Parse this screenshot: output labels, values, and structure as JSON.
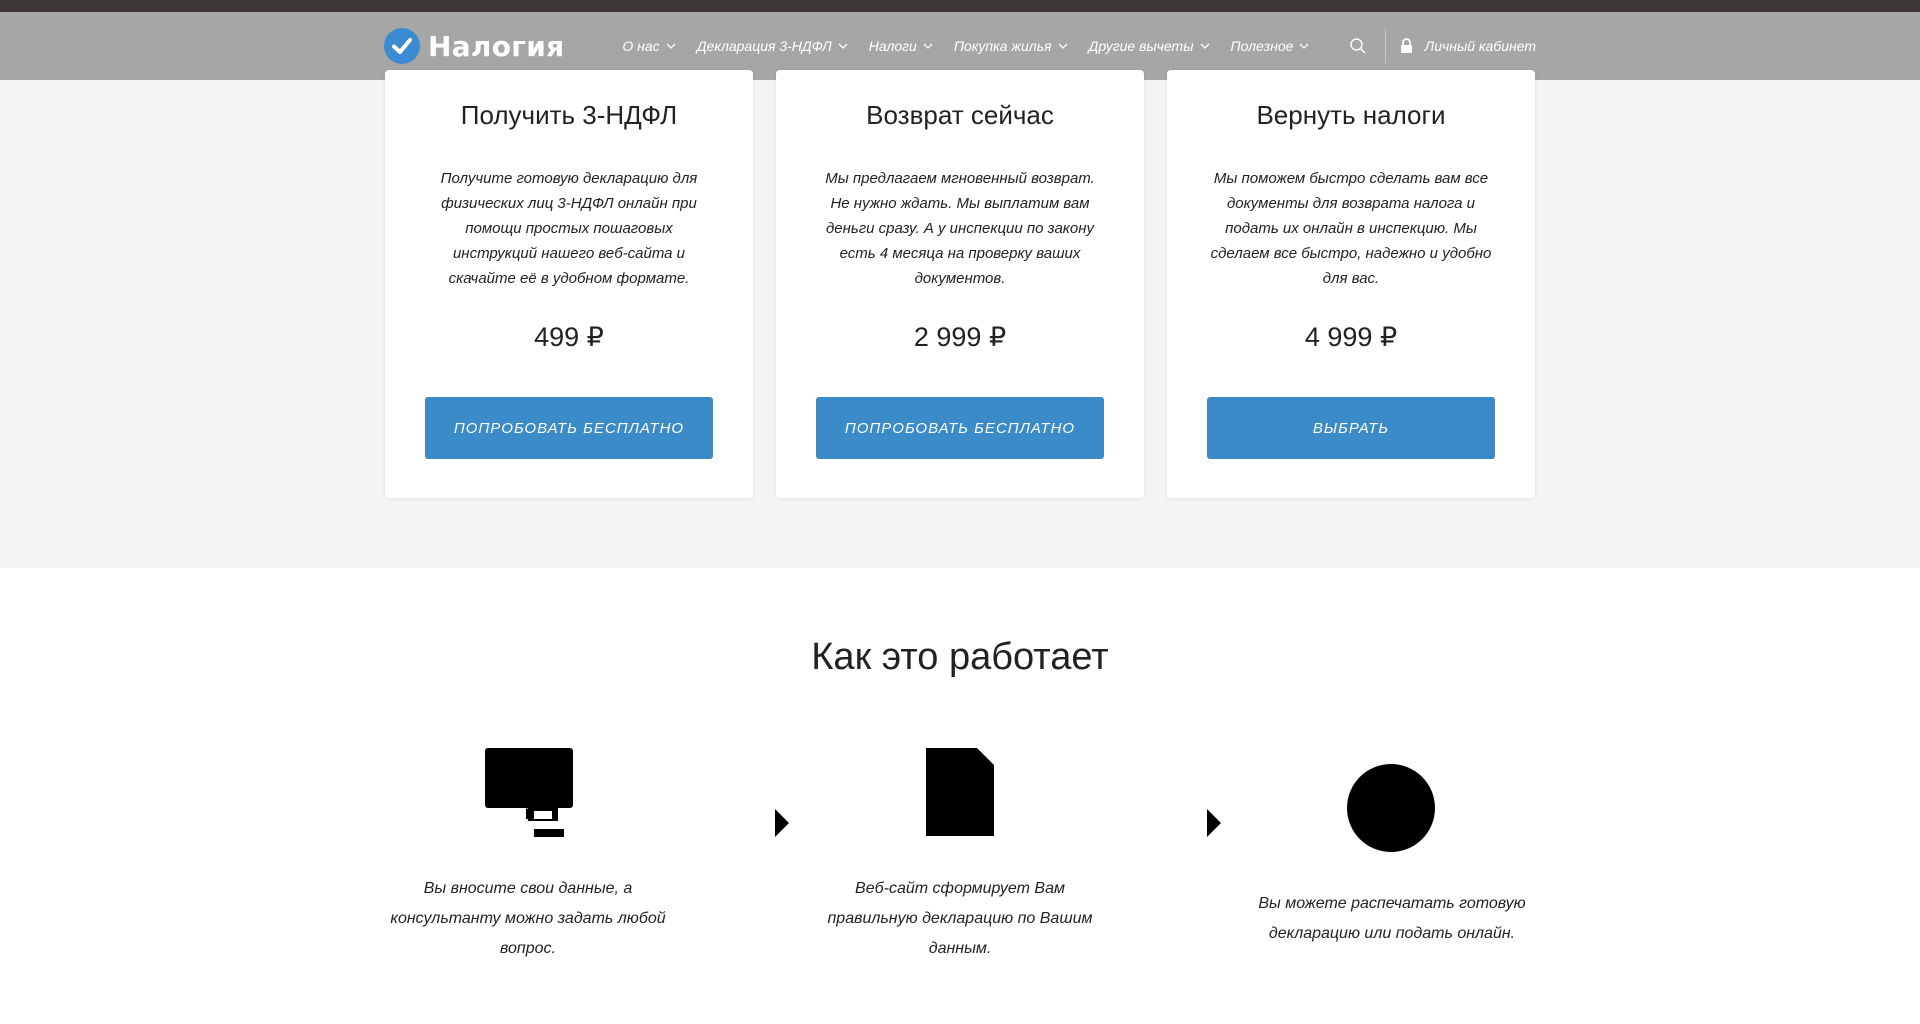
{
  "header": {
    "logo_text": "Налогия",
    "nav": [
      {
        "label": "О нас"
      },
      {
        "label": "Декларация 3-НДФЛ"
      },
      {
        "label": "Налоги"
      },
      {
        "label": "Покупка жилья"
      },
      {
        "label": "Другие вычеты"
      },
      {
        "label": "Полезное"
      }
    ],
    "account_label": "Личный кабинет"
  },
  "pricing": {
    "cards": [
      {
        "title": "Получить 3-НДФЛ",
        "description": "Получите готовую декларацию для физических лиц 3-НДФЛ онлайн при помощи простых пошаговых инструкций нашего веб-сайта и скачайте её в удобном формате.",
        "price": "499 ₽",
        "button": "ПОПРОБОВАТЬ БЕСПЛАТНО"
      },
      {
        "title": "Возврат сейчас",
        "description": "Мы предлагаем мгновенный возврат. Не нужно ждать. Мы выплатим вам деньги сразу. А у инспекции по закону есть 4 месяца на проверку ваших документов.",
        "price": "2 999 ₽",
        "button": "ПОПРОБОВАТЬ БЕСПЛАТНО"
      },
      {
        "title": "Вернуть налоги",
        "description": "Мы поможем быстро сделать вам все документы для возврата налога и подать их онлайн в инспекцию. Мы сделаем все быстро, надежно и удобно для вас.",
        "price": "4 999 ₽",
        "button": "ВЫБРАТЬ"
      }
    ]
  },
  "how_it_works": {
    "title": "Как это работает",
    "steps": [
      {
        "icon": "monitor-icon",
        "text": "Вы вносите свои данные, а консультанту можно задать любой вопрос."
      },
      {
        "icon": "document-icon",
        "text": "Веб-сайт сформирует Вам правильную декларацию по Вашим данным."
      },
      {
        "icon": "circle-icon",
        "text": "Вы можете распечатать готовую декларацию или подать онлайн."
      }
    ]
  },
  "colors": {
    "accent": "#3a8bc8",
    "header_bg": "#a6a6a6",
    "pricing_bg": "#f4f4f4"
  }
}
